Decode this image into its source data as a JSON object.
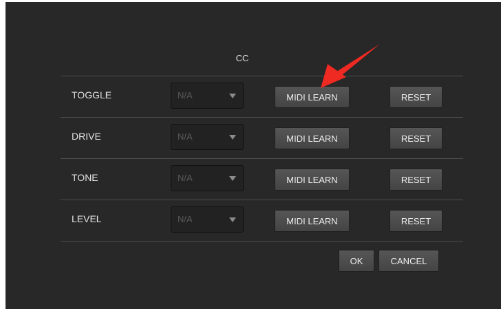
{
  "dialog": {
    "column_header": "CC",
    "rows": [
      {
        "label": "TOGGLE",
        "cc_value": "N/A",
        "midi_learn_label": "MIDI LEARN",
        "reset_label": "RESET"
      },
      {
        "label": "DRIVE",
        "cc_value": "N/A",
        "midi_learn_label": "MIDI LEARN",
        "reset_label": "RESET"
      },
      {
        "label": "TONE",
        "cc_value": "N/A",
        "midi_learn_label": "MIDI LEARN",
        "reset_label": "RESET"
      },
      {
        "label": "LEVEL",
        "cc_value": "N/A",
        "midi_learn_label": "MIDI LEARN",
        "reset_label": "RESET"
      }
    ],
    "ok_label": "OK",
    "cancel_label": "CANCEL"
  },
  "annotation": {
    "color": "#ee2a22",
    "icon": "red-arrow-icon"
  }
}
